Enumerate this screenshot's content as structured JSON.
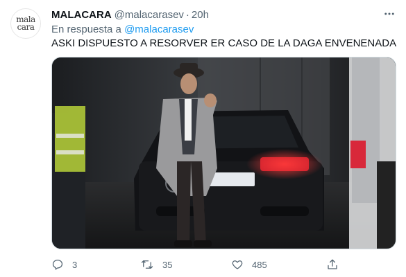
{
  "author": {
    "avatar_text_line1": "mala",
    "avatar_text_line2": "cara",
    "display_name": "MALACARA",
    "handle": "@malacarasev",
    "separator": "·",
    "time": "20h"
  },
  "reply": {
    "prefix": "En respuesta a",
    "mention": "@malacarasev"
  },
  "tweet": {
    "text": "ASKI DISPUESTO A RESORVER ER CASO DE LA DAGA ENVENENADA"
  },
  "media": {
    "description_icon": "photo"
  },
  "actions": {
    "reply_count": "3",
    "retweet_count": "35",
    "like_count": "485",
    "icons": [
      "reply-icon",
      "retweet-icon",
      "like-icon",
      "share-icon"
    ]
  },
  "colors": {
    "link": "#1d9bf0",
    "secondary_text": "#536471",
    "primary_text": "#0f1419"
  }
}
